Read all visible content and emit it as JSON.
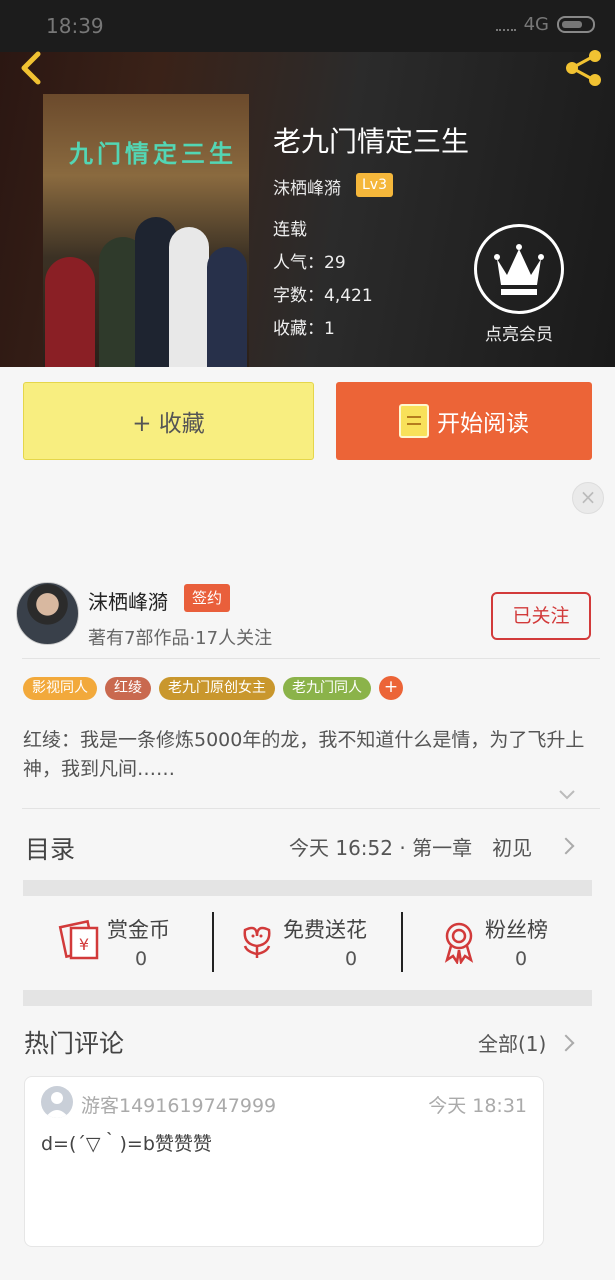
{
  "status_bar": {
    "time": "18:39",
    "network": "4G"
  },
  "book": {
    "cover_title": "九门情定三生",
    "title": "老九门情定三生",
    "author": "沫栖峰漪",
    "level": "Lv3",
    "status": "连载",
    "popularity": "人气：29",
    "word_count": "字数：4,421",
    "favorites": "收藏：1"
  },
  "vip": {
    "label": "点亮会员"
  },
  "actions": {
    "collect": "+ 收藏",
    "read": "开始阅读"
  },
  "author_card": {
    "name": "沫栖峰漪",
    "badge": "签约",
    "stats": "著有7部作品·17人关注",
    "follow_label": "已关注"
  },
  "tags": [
    {
      "label": "影视同人",
      "color": "#f2a93b"
    },
    {
      "label": "红绫",
      "color": "#c9694f"
    },
    {
      "label": "老九门原创女主",
      "color": "#c9972d"
    },
    {
      "label": "老九门同人",
      "color": "#8bb34a"
    }
  ],
  "tag_more": "+",
  "description": "红绫：我是一条修炼5000年的龙，我不知道什么是情，为了飞升上神，我到凡间……",
  "toc": {
    "label": "目录",
    "latest": "今天 16:52 · 第一章　初见"
  },
  "stats": [
    {
      "label": "赏金币",
      "value": "0"
    },
    {
      "label": "免费送花",
      "value": "0"
    },
    {
      "label": "粉丝榜",
      "value": "0"
    }
  ],
  "hot_comments": {
    "title": "热门评论",
    "all_label": "全部(1)",
    "items": [
      {
        "user": "游客1491619747999",
        "time": "今天 18:31",
        "text": "d=(´▽｀)=b赞赞赞"
      }
    ]
  },
  "colors": {
    "accent": "#ec6437",
    "collect_bg": "#f8ee80",
    "follow": "#d23a3a"
  }
}
